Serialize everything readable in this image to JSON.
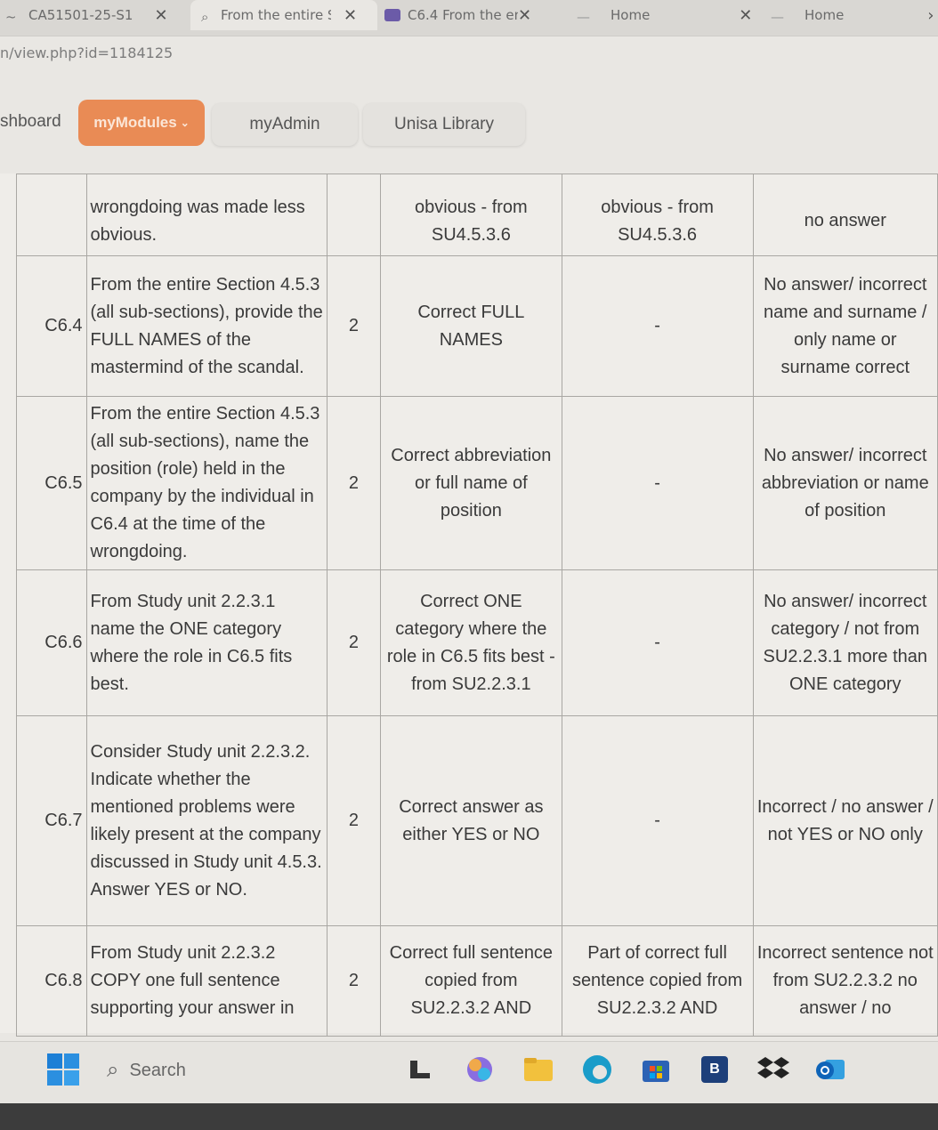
{
  "browser": {
    "tabs": [
      {
        "label": "CA51501-25-S1"
      },
      {
        "label": "From the entire S"
      },
      {
        "label": "C6.4 From the en"
      },
      {
        "label": "Home"
      },
      {
        "label": "Home"
      }
    ],
    "url": "n/view.php?id=1184125"
  },
  "site_nav": {
    "dashboard": "shboard",
    "my_modules": "myModules",
    "my_admin": "myAdmin",
    "library": "Unisa Library"
  },
  "rubric": {
    "top_partial": "wrongdoing was made less obvious.",
    "top_full": "obvious - from SU4.5.3.6",
    "top_part": "obvious - from SU4.5.3.6",
    "top_zero": "no answer",
    "rows": [
      {
        "code": "C6.4",
        "question": "From the entire Section 4.5.3 (all sub-sections), provide the FULL NAMES of the mastermind of the scandal.",
        "marks": "2",
        "full": "Correct FULL NAMES",
        "partial": "-",
        "zero": "No answer/ incorrect name and surname / only name or surname correct"
      },
      {
        "code": "C6.5",
        "question": "From the entire Section 4.5.3 (all sub-sections), name the position (role) held in the company by the individual in C6.4 at the time of the wrongdoing.",
        "marks": "2",
        "full": "Correct abbreviation or full name of position",
        "partial": "-",
        "zero": "No answer/ incorrect abbreviation or name of position"
      },
      {
        "code": "C6.6",
        "question": "From Study unit 2.2.3.1 name the ONE category where the role in C6.5 fits best.",
        "marks": "2",
        "full": "Correct ONE category where the role in C6.5 fits best - from SU2.2.3.1",
        "partial": "-",
        "zero": "No answer/ incorrect category / not from SU2.2.3.1 more than ONE category"
      },
      {
        "code": "C6.7",
        "question": "Consider Study unit 2.2.3.2. Indicate whether the mentioned problems were likely present at the company discussed in Study unit 4.5.3. Answer YES or NO.",
        "marks": "2",
        "full": "Correct answer as either YES or NO",
        "partial": "-",
        "zero": "Incorrect / no answer / not YES or NO only"
      },
      {
        "code": "C6.8",
        "question": "From Study unit 2.2.3.2 COPY one full sentence supporting your answer in",
        "marks": "2",
        "full": "Correct full sentence copied from SU2.2.3.2 AND",
        "partial": "Part of correct full sentence copied from SU2.2.3.2 AND",
        "zero": "Incorrect sentence not from SU2.2.3.2 no answer / no"
      }
    ]
  },
  "taskbar": {
    "search_placeholder": "Search"
  },
  "colors": {
    "accent": "#e98b55",
    "page_bg": "#efede9",
    "taskbar_bg": "#e6e4e0"
  }
}
